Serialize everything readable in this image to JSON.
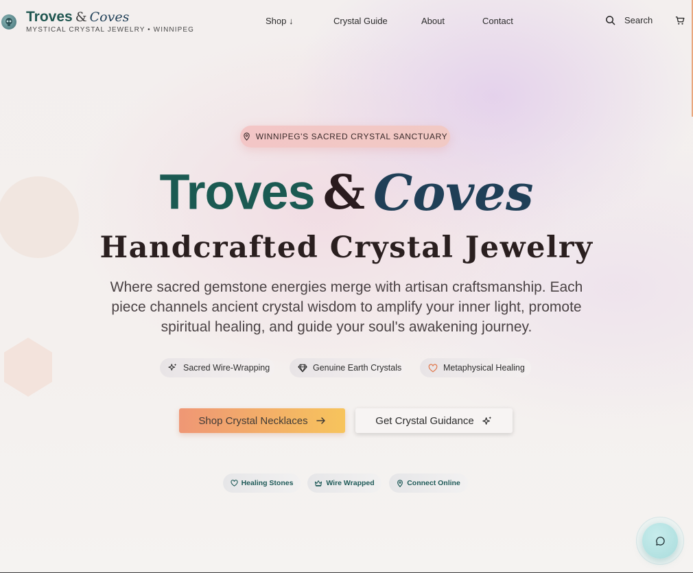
{
  "header": {
    "brand": {
      "troves": "Troves",
      "amp": "&",
      "coves": "Coves"
    },
    "tagline": "MYSTICAL CRYSTAL JEWELRY • WINNIPEG",
    "nav": [
      {
        "label": "Shop ↓"
      },
      {
        "label": "Crystal Guide"
      },
      {
        "label": "About"
      },
      {
        "label": "Contact"
      }
    ],
    "search_label": "Search",
    "icons": {
      "logo": "crystal-skull-icon",
      "search": "search-icon",
      "cart": "cart-icon"
    }
  },
  "hero": {
    "location_pill": "WINNIPEG'S SACRED CRYSTAL SANCTUARY",
    "title": {
      "troves": "Troves",
      "amp": "&",
      "coves": "Coves"
    },
    "subtitle": "Handcrafted Crystal Jewelry",
    "description": "Where sacred gemstone energies merge with artisan craftsmanship. Each piece channels ancient crystal wisdom to amplify your inner light, promote spiritual healing, and guide your soul's awakening journey.",
    "features": [
      {
        "label": "Sacred Wire-Wrapping",
        "icon": "sparkles-icon"
      },
      {
        "label": "Genuine Earth Crystals",
        "icon": "gem-icon"
      },
      {
        "label": "Metaphysical Healing",
        "icon": "heart-icon"
      }
    ],
    "primary_button": "Shop Crystal Necklaces",
    "secondary_button": "Get Crystal Guidance",
    "badges": [
      {
        "label": "Healing Stones",
        "icon": "heart-icon"
      },
      {
        "label": "Wire Wrapped",
        "icon": "crown-icon"
      },
      {
        "label": "Connect Online",
        "icon": "map-pin-icon"
      }
    ]
  },
  "chat": {
    "icon": "chat-bubble-icon"
  },
  "colors": {
    "brand_teal": "#1b5a52",
    "brand_navy": "#1f3f57",
    "accent_peach": "#ef9775",
    "accent_gold": "#f7c45c",
    "pill_pink": "#f3c6c6"
  }
}
